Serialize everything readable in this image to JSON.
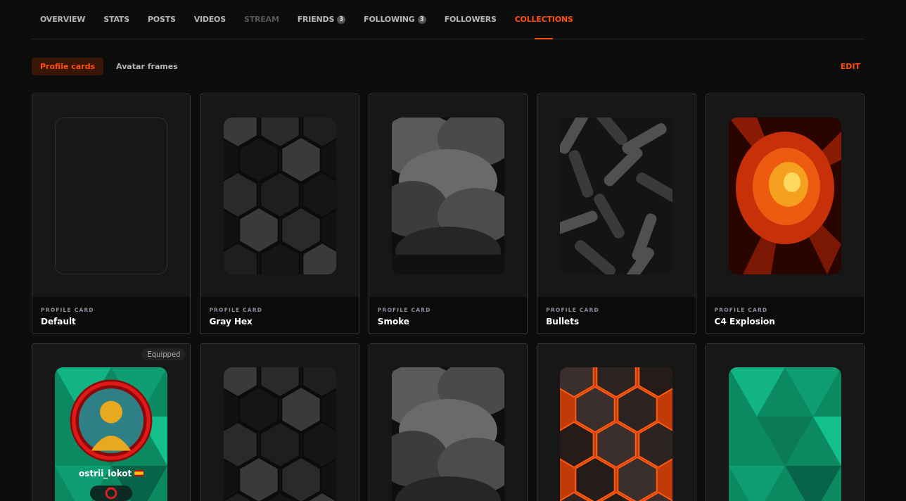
{
  "tabs": [
    {
      "label": "OVERVIEW",
      "selected": false,
      "disabled": false
    },
    {
      "label": "STATS",
      "selected": false,
      "disabled": false
    },
    {
      "label": "POSTS",
      "selected": false,
      "disabled": false
    },
    {
      "label": "VIDEOS",
      "selected": false,
      "disabled": false
    },
    {
      "label": "STREAM",
      "selected": false,
      "disabled": true
    },
    {
      "label": "FRIENDS",
      "selected": false,
      "disabled": false,
      "count": "3"
    },
    {
      "label": "FOLLOWING",
      "selected": false,
      "disabled": false,
      "count": "3"
    },
    {
      "label": "FOLLOWERS",
      "selected": false,
      "disabled": false
    },
    {
      "label": "COLLECTIONS",
      "selected": true,
      "disabled": false
    }
  ],
  "subtabs": [
    {
      "label": "Profile cards",
      "selected": true
    },
    {
      "label": "Avatar frames",
      "selected": false
    }
  ],
  "edit_button": "EDIT",
  "cards": [
    {
      "kind": "empty",
      "label": "PROFILE CARD",
      "name": "Default",
      "equipped": false
    },
    {
      "kind": "hex",
      "label": "PROFILE CARD",
      "name": "Gray Hex",
      "equipped": false
    },
    {
      "kind": "smoke",
      "label": "PROFILE CARD",
      "name": "Smoke",
      "equipped": false
    },
    {
      "kind": "bullets",
      "label": "PROFILE CARD",
      "name": "Bullets",
      "equipped": false
    },
    {
      "kind": "explosion",
      "label": "PROFILE CARD",
      "name": "C4 Explosion",
      "equipped": false
    },
    {
      "kind": "teal",
      "equipped": true,
      "equipped_label": "Equipped",
      "profile": {
        "username": "ostrii_lokot"
      }
    },
    {
      "kind": "hex",
      "equipped": false
    },
    {
      "kind": "smoke",
      "equipped": false
    },
    {
      "kind": "lava",
      "equipped": false
    },
    {
      "kind": "teal",
      "equipped": false
    }
  ]
}
